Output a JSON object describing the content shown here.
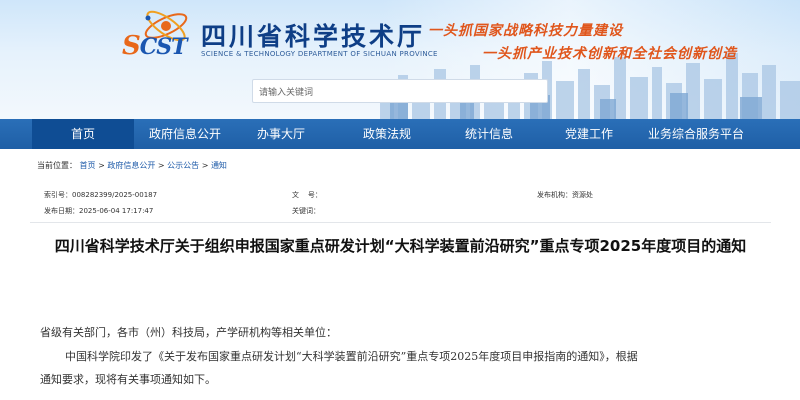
{
  "header": {
    "logo_text": "SCST",
    "site_title": "四川省科学技术厅",
    "site_subtitle": "SCIENCE & TECHNOLOGY DEPARTMENT OF SICHUAN PROVINCE",
    "slogan_line1": "一头抓国家战略科技力量建设",
    "slogan_line2": "一头抓产业技术创新和全社会创新创造",
    "search_placeholder": "请输入关键词"
  },
  "nav": {
    "items": [
      {
        "label": "首页",
        "active": true
      },
      {
        "label": "政府信息公开"
      },
      {
        "label": "办事大厅"
      },
      {
        "label": "政策法规"
      },
      {
        "label": "统计信息"
      },
      {
        "label": "党建工作"
      },
      {
        "label": "业务综合服务平台"
      }
    ]
  },
  "breadcrumb": {
    "prefix": "当前位置：",
    "items": [
      "首页",
      "政府信息公开",
      "公示公告",
      "通知"
    ],
    "separator": ">"
  },
  "meta": {
    "index_label": "索引号：",
    "index_value": "008282399/2025-00187",
    "date_label": "发布日期：",
    "date_value": "2025-06-04 17:17:47",
    "docno_label": "文    号：",
    "keywords_label": "关键词：",
    "issuer_label": "发布机构：",
    "issuer_value": "资源处"
  },
  "article": {
    "title": "四川省科学技术厅关于组织申报国家重点研发计划“大科学装置前沿研究”重点专项2025年度项目的通知",
    "paragraph1": "省级有关部门，各市（州）科技局，产学研机构等相关单位：",
    "paragraph2": "中国科学院印发了《关于发布国家重点研发计划“大科学装置前沿研究”重点专项2025年度项目申报指南的通知》，根据",
    "paragraph3": "通知要求，现将有关事项通知如下。"
  },
  "colors": {
    "nav_bg": "#1f5fa6",
    "nav_active": "#0f4d94",
    "title_blue": "#0e3e86",
    "slogan_orange": "#e0561c",
    "link_blue": "#1d5aa8"
  }
}
